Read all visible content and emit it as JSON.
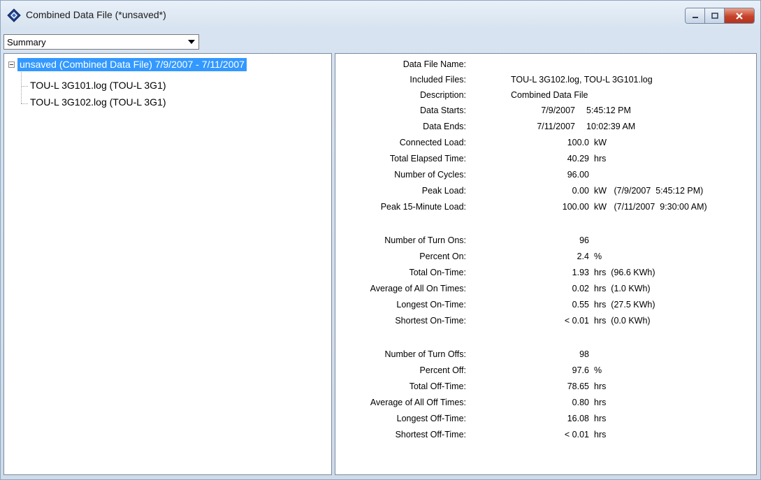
{
  "window": {
    "title": "Combined Data File (*unsaved*)"
  },
  "view_select": {
    "value": "Summary"
  },
  "tree": {
    "root": "unsaved  (Combined Data File) 7/9/2007 - 7/11/2007",
    "children": [
      "TOU-L 3G101.log (TOU-L 3G1)",
      "TOU-L 3G102.log (TOU-L 3G1)"
    ]
  },
  "summary": {
    "data_file_name": {
      "label": "Data File Name:"
    },
    "included_files": {
      "label": "Included Files:",
      "value": "TOU-L 3G102.log, TOU-L 3G101.log"
    },
    "description": {
      "label": "Description:",
      "value": "Combined Data File"
    },
    "data_starts": {
      "label": "Data Starts:",
      "date": "7/9/2007",
      "time": "5:45:12 PM"
    },
    "data_ends": {
      "label": "Data Ends:",
      "date": "7/11/2007",
      "time": "10:02:39 AM"
    },
    "connected_load": {
      "label": "Connected Load:",
      "value": "100.0",
      "unit": "kW"
    },
    "total_elapsed": {
      "label": "Total Elapsed Time:",
      "value": "40.29",
      "unit": "hrs"
    },
    "num_cycles": {
      "label": "Number of Cycles:",
      "value": "96.00"
    },
    "peak_load": {
      "label": "Peak Load:",
      "value": "0.00",
      "unit": "kW   (7/9/2007  5:45:12 PM)"
    },
    "peak_15": {
      "label": "Peak 15-Minute Load:",
      "value": "100.00",
      "unit": "kW   (7/11/2007  9:30:00 AM)"
    },
    "turn_ons": {
      "label": "Number of Turn Ons:",
      "value": "96"
    },
    "percent_on": {
      "label": "Percent On:",
      "value": "2.4",
      "unit": "%"
    },
    "total_on": {
      "label": "Total On-Time:",
      "value": "1.93",
      "unit": "hrs  (96.6 KWh)"
    },
    "avg_on": {
      "label": "Average of All On Times:",
      "value": "0.02",
      "unit": "hrs  (1.0 KWh)"
    },
    "longest_on": {
      "label": "Longest On-Time:",
      "value": "0.55",
      "unit": "hrs  (27.5 KWh)"
    },
    "shortest_on": {
      "label": "Shortest On-Time:",
      "value": "< 0.01",
      "unit": "hrs  (0.0 KWh)"
    },
    "turn_offs": {
      "label": "Number of Turn Offs:",
      "value": "98"
    },
    "percent_off": {
      "label": "Percent Off:",
      "value": "97.6",
      "unit": "%"
    },
    "total_off": {
      "label": "Total Off-Time:",
      "value": "78.65",
      "unit": "hrs"
    },
    "avg_off": {
      "label": "Average of All Off Times:",
      "value": "0.80",
      "unit": "hrs"
    },
    "longest_off": {
      "label": "Longest Off-Time:",
      "value": "16.08",
      "unit": "hrs"
    },
    "shortest_off": {
      "label": "Shortest Off-Time:",
      "value": "< 0.01",
      "unit": "hrs"
    }
  }
}
